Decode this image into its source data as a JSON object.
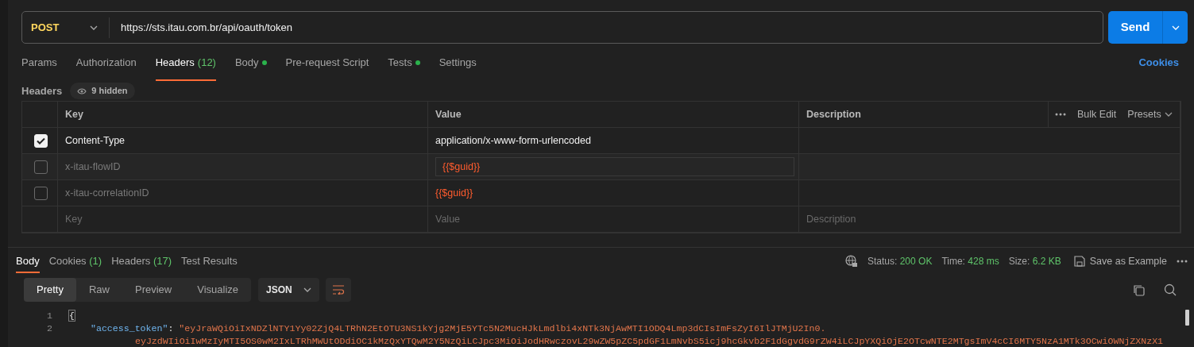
{
  "request": {
    "method": "POST",
    "url": "https://sts.itau.com.br/api/oauth/token",
    "send_label": "Send"
  },
  "request_tabs": [
    {
      "label": "Params",
      "dot": false,
      "selected": false
    },
    {
      "label": "Authorization",
      "dot": false,
      "selected": false
    },
    {
      "label": "Headers",
      "count": "(12)",
      "dot": false,
      "selected": true
    },
    {
      "label": "Body",
      "dot": true,
      "selected": false
    },
    {
      "label": "Pre-request Script",
      "dot": false,
      "selected": false
    },
    {
      "label": "Tests",
      "dot": true,
      "selected": false
    },
    {
      "label": "Settings",
      "dot": false,
      "selected": false
    }
  ],
  "cookies_link": "Cookies",
  "headers_section": {
    "label": "Headers",
    "hidden_label": "9 hidden"
  },
  "table": {
    "columns": [
      "Key",
      "Value",
      "Description"
    ],
    "bulk_edit": "Bulk Edit",
    "presets": "Presets",
    "rows": [
      {
        "checked": true,
        "key": "Content-Type",
        "value": "application/x-www-form-urlencoded",
        "variable": false,
        "focused": false
      },
      {
        "checked": false,
        "key": "x-itau-flowID",
        "value": "{{$guid}}",
        "variable": true,
        "focused": true
      },
      {
        "checked": false,
        "key": "x-itau-correlationID",
        "value": "{{$guid}}",
        "variable": true,
        "focused": false
      }
    ],
    "new_row": {
      "key_placeholder": "Key",
      "value_placeholder": "Value",
      "description_placeholder": "Description"
    }
  },
  "response": {
    "tabs": [
      {
        "label": "Body",
        "selected": true
      },
      {
        "label": "Cookies",
        "count": "(1)",
        "selected": false
      },
      {
        "label": "Headers",
        "count": "(17)",
        "selected": false
      },
      {
        "label": "Test Results",
        "selected": false
      }
    ],
    "stats": [
      {
        "label": "Status:",
        "value": "200 OK"
      },
      {
        "label": "Time:",
        "value": "428 ms"
      },
      {
        "label": "Size:",
        "value": "6.2 KB"
      }
    ],
    "save_label": "Save as Example",
    "views": [
      {
        "label": "Pretty",
        "selected": true
      },
      {
        "label": "Raw",
        "selected": false
      },
      {
        "label": "Preview",
        "selected": false
      },
      {
        "label": "Visualize",
        "selected": false
      }
    ],
    "format": "JSON",
    "lines": [
      {
        "number": "1",
        "kind": "open",
        "tokens": [
          {
            "kind": "punct",
            "text": "{"
          }
        ]
      },
      {
        "number": "2",
        "kind": "entry",
        "tokens": [
          {
            "kind": "key",
            "text": "\"access_token\""
          },
          {
            "kind": "punct",
            "text": ": "
          },
          {
            "kind": "string",
            "text": "\"eyJraWQiOiIxNDZlNTY1Yy02ZjQ4LTRhN2EtOTU3NS1kYjg2MjE5YTc5N2MucHJkLmdlbi4xNTk3NjAwMTI1ODQ4Lmp3dCIsImFsZyI6IlJTMjU2In0."
          }
        ]
      },
      {
        "kind": "wrap",
        "tokens": [
          {
            "kind": "string",
            "text": "eyJzdWIiOiIwMzIyMTI5OS0wM2IxLTRhMWUtODdiOC1kMzQxYTQwM2Y5NzQiLCJpc3MiOiJodHRwczovL29wZW5pZC5pdGF1LmNvbS5icj9hcGkvb2F1dGgvdG9rZW4iLCJpYXQiOjE2OTcwNTE2MTgsImV4cCI6MTY5NzA1MTk3OCwiOWNjZXNzX1"
          }
        ]
      }
    ]
  }
}
